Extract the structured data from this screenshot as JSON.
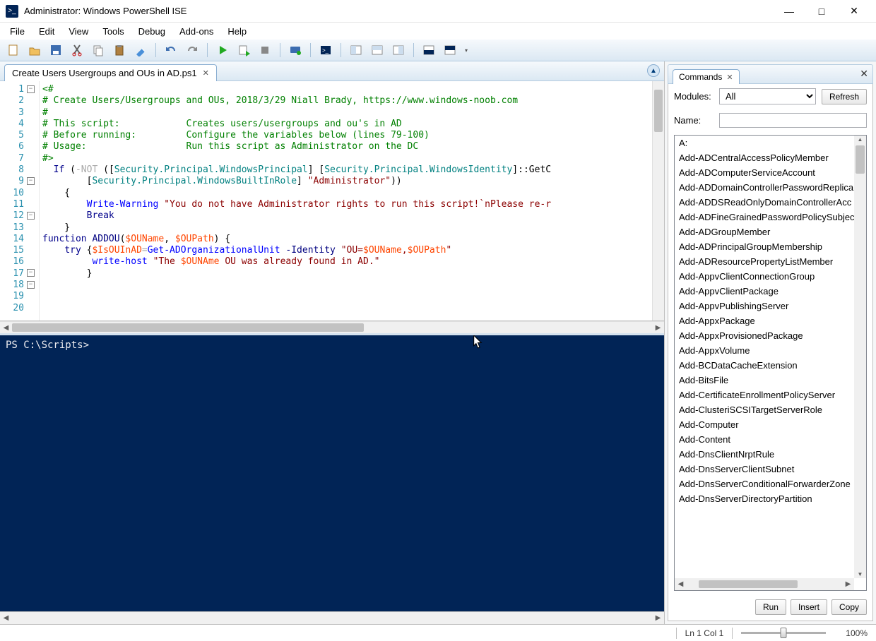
{
  "title": "Administrator: Windows PowerShell ISE",
  "menu": [
    "File",
    "Edit",
    "View",
    "Tools",
    "Debug",
    "Add-ons",
    "Help"
  ],
  "toolbar_icons": [
    "new",
    "open",
    "save",
    "cut",
    "copy",
    "paste",
    "clear",
    "",
    "undo",
    "redo",
    "",
    "run",
    "run-selection",
    "stop",
    "",
    "remote",
    "",
    "console",
    "",
    "panes-1",
    "panes-2",
    "panes-3",
    "",
    "layout-a",
    "layout-b"
  ],
  "editor_tab": "Create Users  Usergroups and OUs in AD.ps1",
  "code_lines": [
    {
      "n": 1,
      "fold": "-",
      "segs": [
        {
          "t": "<#",
          "c": "c-comment"
        }
      ]
    },
    {
      "n": 2,
      "segs": [
        {
          "t": "# Create Users/Usergroups and OUs, 2018/3/29 Niall Brady, https://www.windows-noob.com",
          "c": "c-comment"
        }
      ]
    },
    {
      "n": 3,
      "segs": [
        {
          "t": "#",
          "c": "c-comment"
        }
      ]
    },
    {
      "n": 4,
      "segs": [
        {
          "t": "# This script:            Creates users/usergroups and ou's in AD",
          "c": "c-comment"
        }
      ]
    },
    {
      "n": 5,
      "segs": [
        {
          "t": "# Before running:         Configure the variables below (lines 79-100)",
          "c": "c-comment"
        }
      ]
    },
    {
      "n": 6,
      "segs": [
        {
          "t": "# Usage:                  Run this script as Administrator on the DC",
          "c": "c-comment"
        }
      ]
    },
    {
      "n": 7,
      "segs": [
        {
          "t": "#>",
          "c": "c-comment"
        }
      ]
    },
    {
      "n": 8,
      "segs": [
        {
          "t": "",
          "c": ""
        }
      ]
    },
    {
      "n": 9,
      "fold": "-",
      "segs": [
        {
          "t": "  ",
          "c": ""
        },
        {
          "t": "If",
          "c": "c-keyword"
        },
        {
          "t": " (",
          "c": "c-black"
        },
        {
          "t": "-NOT",
          "c": "c-gray"
        },
        {
          "t": " (",
          "c": "c-black"
        },
        {
          "t": "[",
          "c": "c-black"
        },
        {
          "t": "Security.Principal.WindowsPrincipal",
          "c": "c-type"
        },
        {
          "t": "]",
          "c": "c-black"
        },
        {
          "t": " ",
          "c": ""
        },
        {
          "t": "[",
          "c": "c-black"
        },
        {
          "t": "Security.Principal.WindowsIdentity",
          "c": "c-type"
        },
        {
          "t": "]",
          "c": "c-black"
        },
        {
          "t": "::",
          "c": "c-black"
        },
        {
          "t": "GetC",
          "c": "c-black"
        }
      ]
    },
    {
      "n": 10,
      "segs": [
        {
          "t": "        ",
          "c": ""
        },
        {
          "t": "[",
          "c": "c-black"
        },
        {
          "t": "Security.Principal.WindowsBuiltInRole",
          "c": "c-type"
        },
        {
          "t": "]",
          "c": "c-black"
        },
        {
          "t": " ",
          "c": ""
        },
        {
          "t": "\"Administrator\"",
          "c": "c-string"
        },
        {
          "t": "))",
          "c": "c-black"
        }
      ]
    },
    {
      "n": 11,
      "segs": [
        {
          "t": "",
          "c": ""
        }
      ]
    },
    {
      "n": 12,
      "fold": "-",
      "segs": [
        {
          "t": "    {",
          "c": "c-black"
        }
      ]
    },
    {
      "n": 13,
      "segs": [
        {
          "t": "        ",
          "c": ""
        },
        {
          "t": "Write-Warning",
          "c": "c-cmd"
        },
        {
          "t": " ",
          "c": ""
        },
        {
          "t": "\"You do not have Administrator rights to run this script!`nPlease re-r",
          "c": "c-string"
        }
      ]
    },
    {
      "n": 14,
      "segs": [
        {
          "t": "        ",
          "c": ""
        },
        {
          "t": "Break",
          "c": "c-keyword"
        }
      ]
    },
    {
      "n": 15,
      "segs": [
        {
          "t": "    }",
          "c": "c-black"
        }
      ]
    },
    {
      "n": 16,
      "segs": [
        {
          "t": "",
          "c": ""
        }
      ]
    },
    {
      "n": 17,
      "fold": "-",
      "segs": [
        {
          "t": "function",
          "c": "c-keyword"
        },
        {
          "t": " ",
          "c": ""
        },
        {
          "t": "ADDOU",
          "c": "c-attr"
        },
        {
          "t": "(",
          "c": "c-black"
        },
        {
          "t": "$OUName",
          "c": "c-var"
        },
        {
          "t": ", ",
          "c": "c-black"
        },
        {
          "t": "$OUPath",
          "c": "c-var"
        },
        {
          "t": ") {",
          "c": "c-black"
        }
      ]
    },
    {
      "n": 18,
      "fold": "-",
      "segs": [
        {
          "t": "    ",
          "c": ""
        },
        {
          "t": "try",
          "c": "c-keyword"
        },
        {
          "t": " {",
          "c": "c-black"
        },
        {
          "t": "$IsOUInAD",
          "c": "c-var"
        },
        {
          "t": "=",
          "c": "c-gray"
        },
        {
          "t": "Get-ADOrganizationalUnit",
          "c": "c-cmd"
        },
        {
          "t": " ",
          "c": ""
        },
        {
          "t": "-Identity",
          "c": "c-attr"
        },
        {
          "t": " ",
          "c": ""
        },
        {
          "t": "\"OU=",
          "c": "c-string"
        },
        {
          "t": "$OUName",
          "c": "c-var"
        },
        {
          "t": ",",
          "c": "c-string"
        },
        {
          "t": "$OUPath",
          "c": "c-var"
        },
        {
          "t": "\"",
          "c": "c-string"
        }
      ]
    },
    {
      "n": 19,
      "segs": [
        {
          "t": "         ",
          "c": ""
        },
        {
          "t": "write-host",
          "c": "c-cmd"
        },
        {
          "t": " ",
          "c": ""
        },
        {
          "t": "\"The ",
          "c": "c-string"
        },
        {
          "t": "$OUNAme",
          "c": "c-var"
        },
        {
          "t": " OU was already found in AD.\"",
          "c": "c-string"
        }
      ]
    },
    {
      "n": 20,
      "segs": [
        {
          "t": "        }",
          "c": "c-black"
        }
      ]
    }
  ],
  "console_prompt": "PS C:\\Scripts>",
  "commands_panel": {
    "title": "Commands",
    "modules_label": "Modules:",
    "modules_value": "All",
    "name_label": "Name:",
    "refresh": "Refresh",
    "list": [
      "A:",
      "Add-ADCentralAccessPolicyMember",
      "Add-ADComputerServiceAccount",
      "Add-ADDomainControllerPasswordReplica",
      "Add-ADDSReadOnlyDomainControllerAcc",
      "Add-ADFineGrainedPasswordPolicySubjec",
      "Add-ADGroupMember",
      "Add-ADPrincipalGroupMembership",
      "Add-ADResourcePropertyListMember",
      "Add-AppvClientConnectionGroup",
      "Add-AppvClientPackage",
      "Add-AppvPublishingServer",
      "Add-AppxPackage",
      "Add-AppxProvisionedPackage",
      "Add-AppxVolume",
      "Add-BCDataCacheExtension",
      "Add-BitsFile",
      "Add-CertificateEnrollmentPolicyServer",
      "Add-ClusteriSCSITargetServerRole",
      "Add-Computer",
      "Add-Content",
      "Add-DnsClientNrptRule",
      "Add-DnsServerClientSubnet",
      "Add-DnsServerConditionalForwarderZone",
      "Add-DnsServerDirectoryPartition"
    ],
    "run": "Run",
    "insert": "Insert",
    "copy": "Copy"
  },
  "status": {
    "pos": "Ln 1  Col 1",
    "zoom": "100%"
  }
}
